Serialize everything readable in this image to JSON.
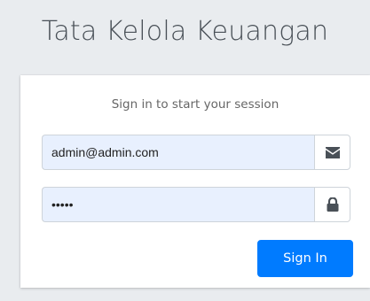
{
  "header": {
    "title": "Tata Kelola Keuangan"
  },
  "login": {
    "message": "Sign in to start your session",
    "email": {
      "value": "admin@admin.com",
      "icon": "envelope-icon"
    },
    "password": {
      "value": "•••••",
      "icon": "lock-icon"
    },
    "submit_label": "Sign In"
  },
  "colors": {
    "background": "#e9ecef",
    "card": "#ffffff",
    "autofill": "#e8f0fe",
    "primary": "#007bff",
    "icon": "#495057"
  }
}
